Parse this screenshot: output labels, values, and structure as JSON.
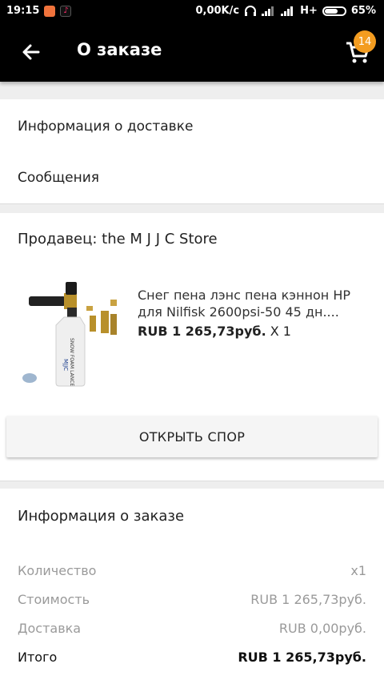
{
  "status_bar": {
    "time": "19:15",
    "network_speed": "0,00K/c",
    "network_type": "H+",
    "battery_percent": "65%",
    "battery_level": 0.65
  },
  "header": {
    "title": "О заказе",
    "cart_count": "14",
    "accent_color": "#f39c20"
  },
  "sections": {
    "delivery_info": "Информация о доставке",
    "messages": "Сообщения"
  },
  "seller": {
    "label": "Продавец: the M J J C Store"
  },
  "product": {
    "title": "Снег пена лэнс пена кэннон HP для Nilfisk 2600psi-50 45 дн....",
    "price": "RUB 1 265,73руб.",
    "quantity": "X 1",
    "image_text": "SNOW FOAM LANCE",
    "image_brand": "MJJC"
  },
  "dispute_button": "ОТКРЫТЬ СПОР",
  "order_info": {
    "heading": "Информация о заказе",
    "rows": [
      {
        "label": "Количество",
        "value": "x1"
      },
      {
        "label": "Стоимость",
        "value": "RUB 1 265,73руб."
      },
      {
        "label": "Доставка",
        "value": "RUB 0,00руб."
      },
      {
        "label": "Итого",
        "value": "RUB 1 265,73руб."
      }
    ]
  }
}
